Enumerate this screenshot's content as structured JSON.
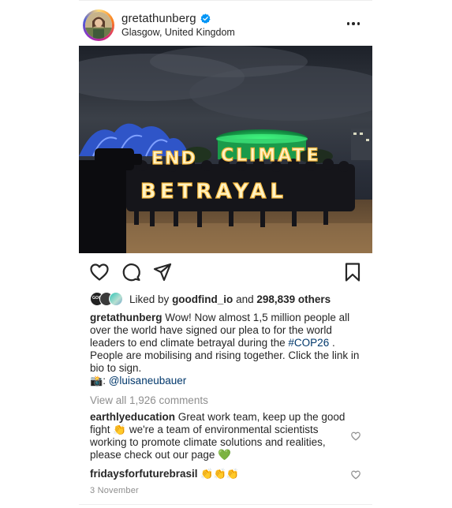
{
  "post": {
    "username": "gretathunberg",
    "location": "Glasgow, United Kingdom",
    "verified_icon": "verified-badge-icon",
    "photo_sign_line1": "END CLIMATE",
    "photo_sign_line2": "BETRAYAL"
  },
  "actions": {
    "like_icon": "heart-icon",
    "comment_icon": "comment-bubble-icon",
    "share_icon": "paper-plane-icon",
    "save_icon": "bookmark-icon"
  },
  "likes": {
    "prefix": "Liked by",
    "user": "goodfind_io",
    "joiner": "and",
    "count": "298,839 others"
  },
  "caption": {
    "username": "gretathunberg",
    "text1": "Wow! Now almost 1,5 million people all over the world have signed our plea to for the world leaders to end climate betrayal during the",
    "hashtag": "#COP26",
    "text2": ". People are mobilising and rising together. Click the link in bio to sign.",
    "camera_emoji": "📸",
    "credit_sep": ":",
    "credit": "@luisaneubauer"
  },
  "view_comments": "View all 1,926 comments",
  "comments": [
    {
      "username": "earthlyeducation",
      "text": "Great work team, keep up the good fight 👏 we're a team of environmental scientists working to promote climate solutions and realities, please check out our page 💚"
    },
    {
      "username": "fridaysforfuturebrasil",
      "text": "👏👏👏"
    }
  ],
  "date": "3 November",
  "colors": {
    "text": "#262626",
    "muted": "#8e8e8e",
    "link": "#00376b",
    "verified": "#0095f6"
  }
}
